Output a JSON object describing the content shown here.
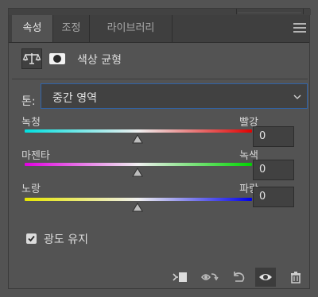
{
  "tabs": [
    {
      "label": "속성"
    },
    {
      "label": "조정"
    },
    {
      "label": "라이브러리"
    }
  ],
  "adjustment": {
    "title": "색상 균형",
    "icons": [
      "balance-scale-icon",
      "layer-mask-icon"
    ]
  },
  "tone": {
    "label": "톤:",
    "selected": "중간 영역"
  },
  "sliders": [
    {
      "left_label": "녹청",
      "right_label": "빨강",
      "value": "0",
      "gradient": [
        "#00e6e6",
        "#e60000"
      ]
    },
    {
      "left_label": "마젠타",
      "right_label": "녹색",
      "value": "0",
      "gradient": [
        "#e600e6",
        "#00e600"
      ]
    },
    {
      "left_label": "노랑",
      "right_label": "파랑",
      "value": "0",
      "gradient": [
        "#e6e600",
        "#0000e6"
      ]
    }
  ],
  "preserve_luminosity": {
    "label": "광도 유지",
    "checked": true
  },
  "bottom_icons": [
    "clip-to-layer-icon",
    "view-previous-state-icon",
    "reset-icon",
    "visibility-eye-icon",
    "trash-icon"
  ],
  "colors": {
    "panel_bg": "#535353",
    "accent_border": "#2f63a8"
  }
}
